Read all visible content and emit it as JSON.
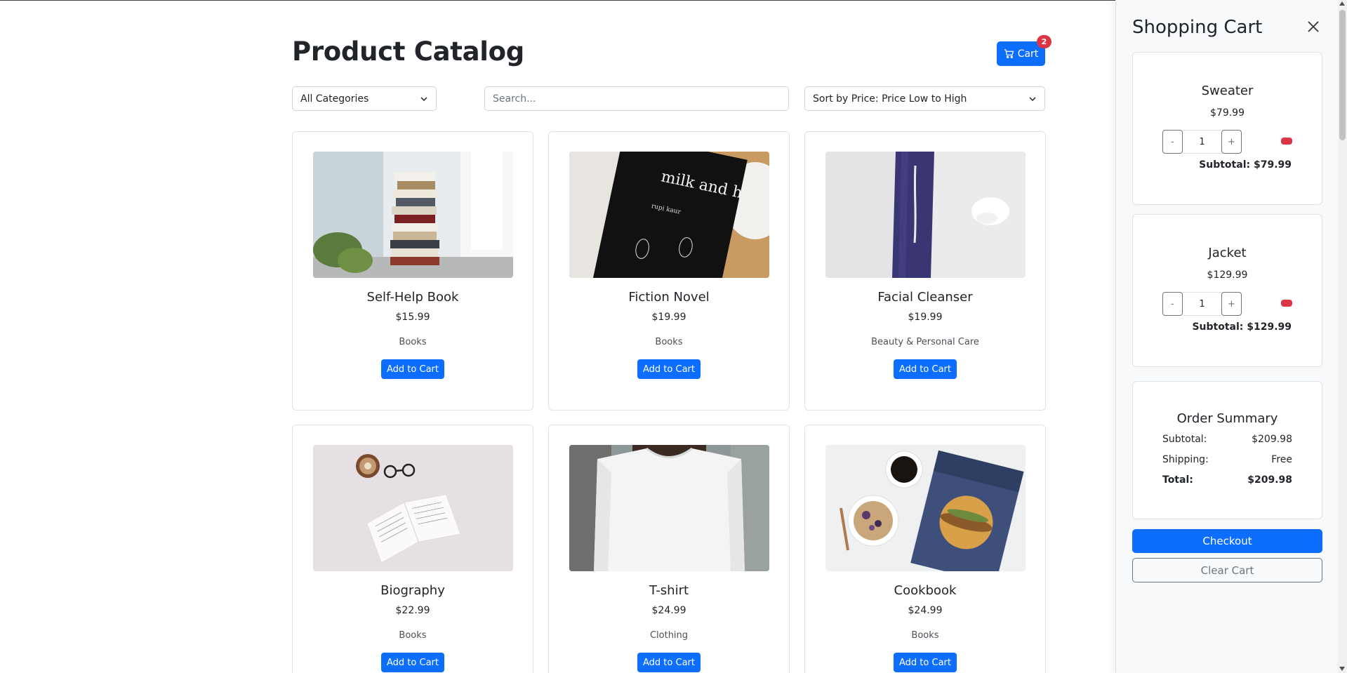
{
  "header": {
    "title": "Product Catalog",
    "cart_label": "Cart",
    "cart_count": "2"
  },
  "filters": {
    "category": "All Categories",
    "search_placeholder": "Search...",
    "sort": "Sort by Price: Price Low to High"
  },
  "products": [
    {
      "name": "Self-Help Book",
      "price": "$15.99",
      "category": "Books",
      "button": "Add to Cart",
      "image": "book-stack-photo"
    },
    {
      "name": "Fiction Novel",
      "price": "$19.99",
      "category": "Books",
      "button": "Add to Cart",
      "image": "milk-and-honey-book-photo"
    },
    {
      "name": "Facial Cleanser",
      "price": "$19.99",
      "category": "Beauty & Personal Care",
      "button": "Add to Cart",
      "image": "cleanser-tube-photo"
    },
    {
      "name": "Biography",
      "price": "$22.99",
      "category": "Books",
      "button": "Add to Cart",
      "image": "open-book-coffee-photo"
    },
    {
      "name": "T-shirt",
      "price": "$24.99",
      "category": "Clothing",
      "button": "Add to Cart",
      "image": "white-tshirt-photo"
    },
    {
      "name": "Cookbook",
      "price": "$24.99",
      "category": "Books",
      "button": "Add to Cart",
      "image": "superfood-cookbook-photo"
    }
  ],
  "book_cover_text": {
    "title": "milk and honey",
    "author": "rupi kaur"
  },
  "cart": {
    "title": "Shopping Cart",
    "items": [
      {
        "name": "Sweater",
        "price": "$79.99",
        "qty": "1",
        "minus": "-",
        "plus": "+",
        "subtotal": "Subtotal: $79.99"
      },
      {
        "name": "Jacket",
        "price": "$129.99",
        "qty": "1",
        "minus": "-",
        "plus": "+",
        "subtotal": "Subtotal: $129.99"
      }
    ],
    "summary": {
      "title": "Order Summary",
      "subtotal_label": "Subtotal:",
      "subtotal_value": "$209.98",
      "shipping_label": "Shipping:",
      "shipping_value": "Free",
      "total_label": "Total:",
      "total_value": "$209.98"
    },
    "checkout_label": "Checkout",
    "clear_label": "Clear Cart"
  },
  "colors": {
    "primary": "#0d6efd",
    "danger": "#dc3545",
    "secondary": "#6c757d"
  }
}
